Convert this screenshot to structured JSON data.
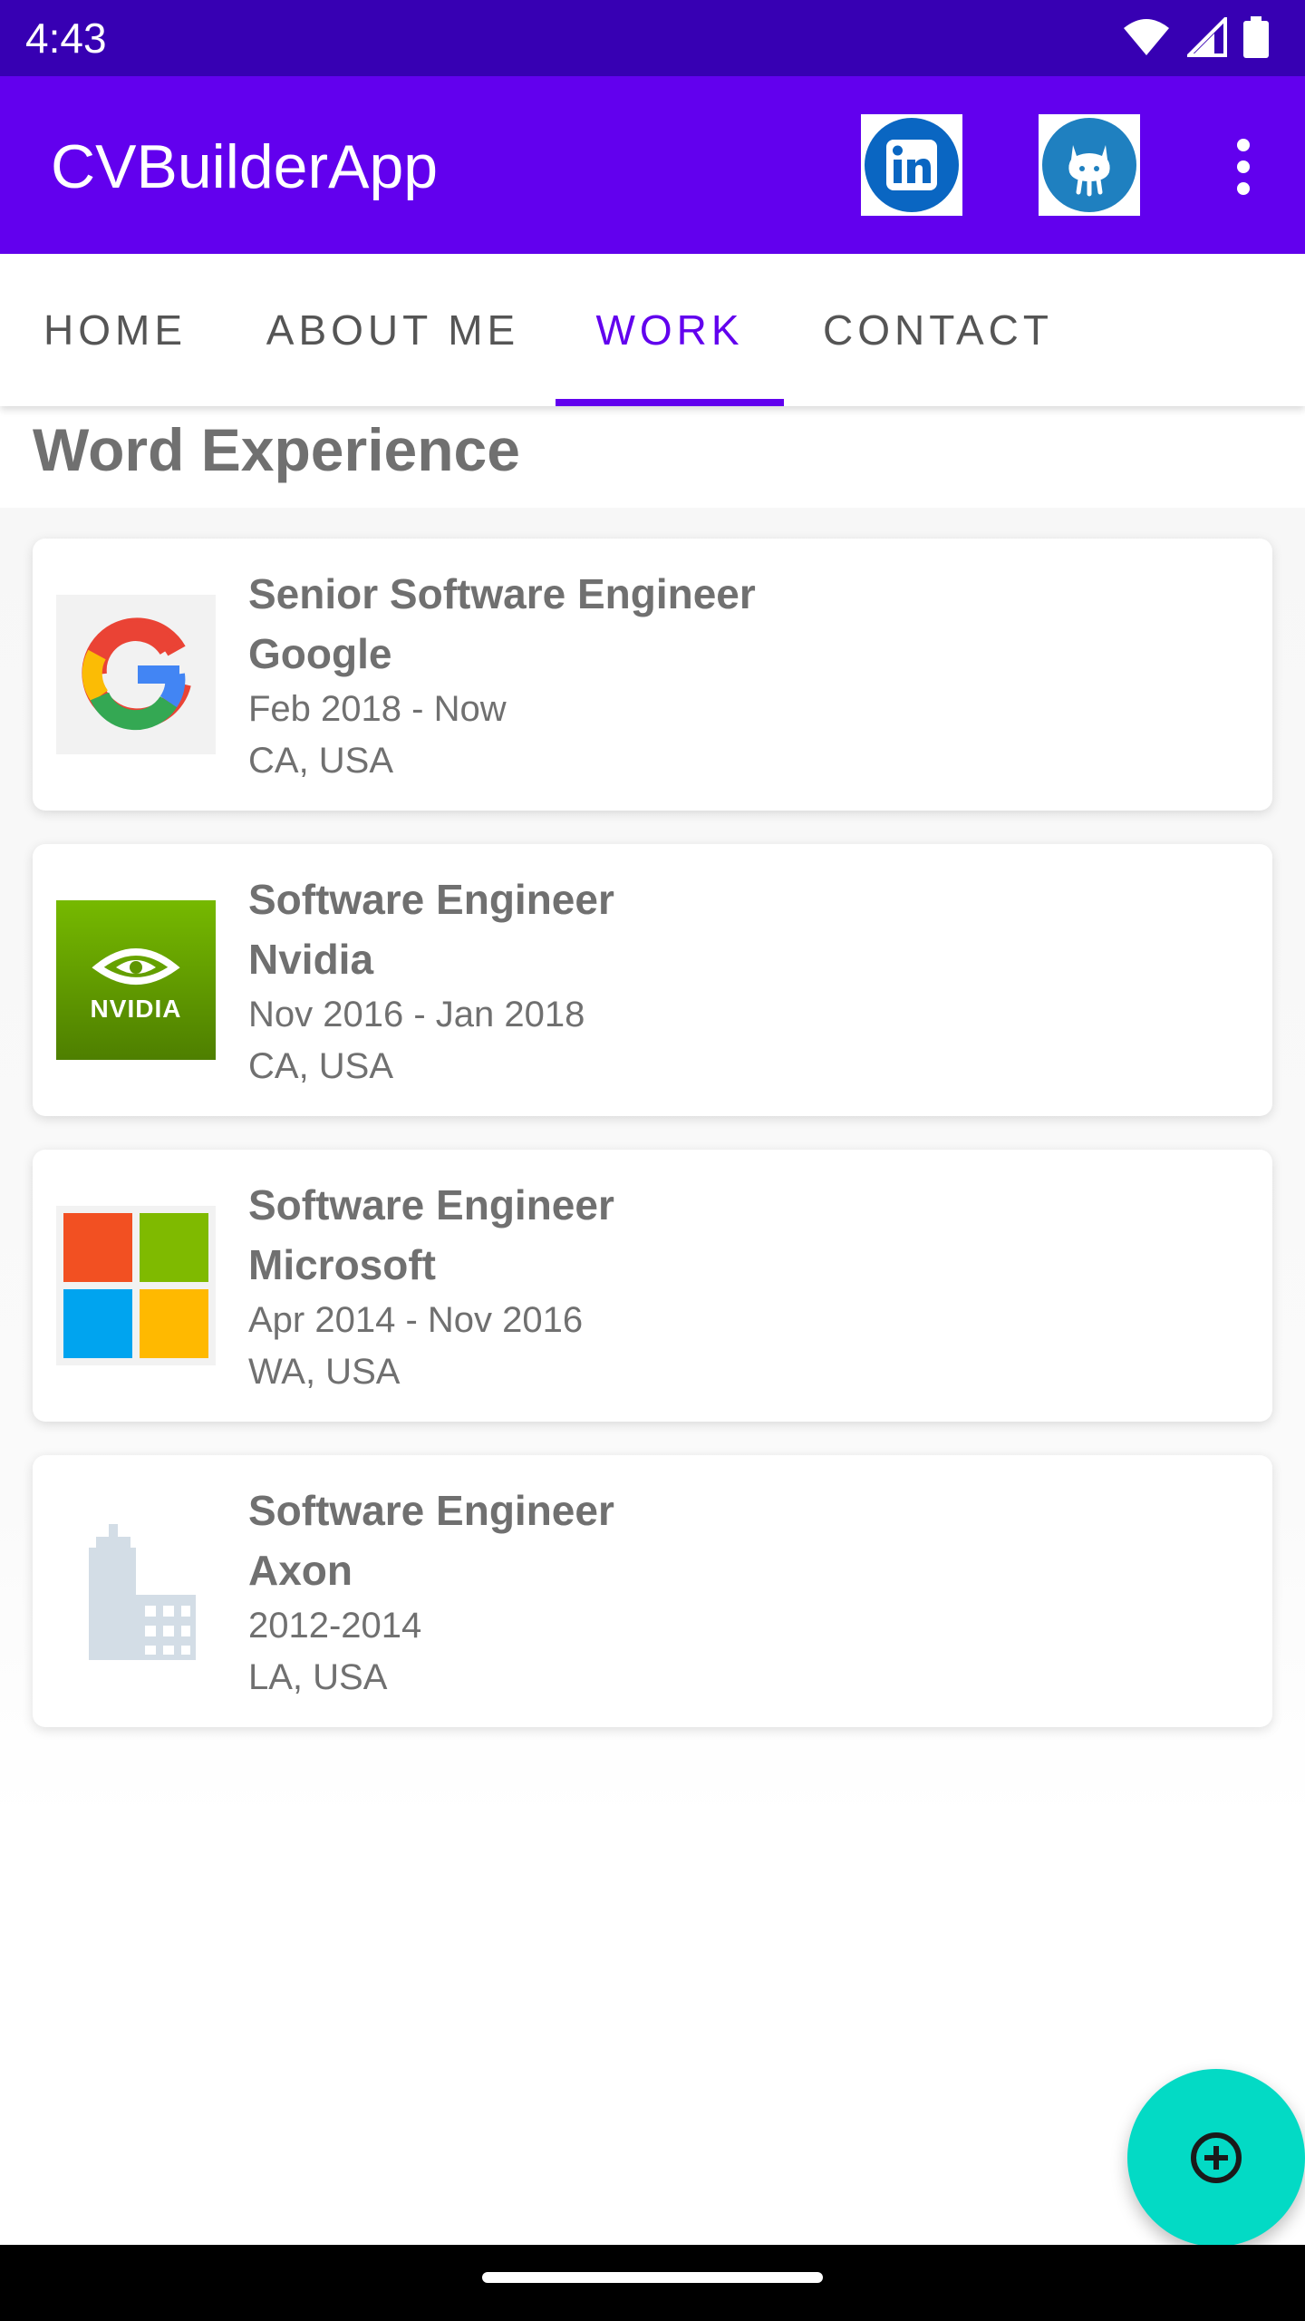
{
  "status_bar": {
    "time": "4:43"
  },
  "app_bar": {
    "title": "CVBuilderApp",
    "linkedin_icon": "linkedin-icon",
    "github_icon": "github-icon",
    "overflow_icon": "more-vert-icon"
  },
  "tabs": [
    {
      "label": "Home",
      "active": false
    },
    {
      "label": "About Me",
      "active": false
    },
    {
      "label": "Work",
      "active": true
    },
    {
      "label": "Contact",
      "active": false
    }
  ],
  "section_title": "Word Experience",
  "jobs": [
    {
      "role": "Senior Software Engineer",
      "company": "Google",
      "dates": "Feb 2018 - Now",
      "location": "CA, USA",
      "logo": "google-logo"
    },
    {
      "role": "Software Engineer",
      "company": "Nvidia",
      "dates": "Nov 2016 - Jan 2018",
      "location": "CA, USA",
      "logo": "nvidia-logo",
      "logo_text": "NVIDIA"
    },
    {
      "role": "Software Engineer",
      "company": "Microsoft",
      "dates": "Apr 2014 - Nov 2016",
      "location": "WA, USA",
      "logo": "microsoft-logo"
    },
    {
      "role": "Software Engineer",
      "company": "Axon",
      "dates": "2012-2014",
      "location": "LA, USA",
      "logo": "building-icon"
    }
  ],
  "fab": {
    "icon": "add-circle-icon"
  },
  "colors": {
    "primary": "#6200ee",
    "primary_dark": "#3700b3",
    "accent": "#03dac5",
    "text_gray": "#707070"
  }
}
